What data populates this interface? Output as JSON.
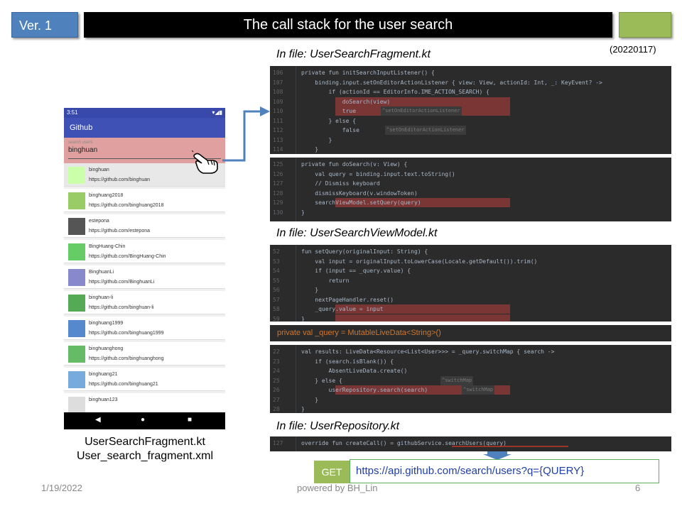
{
  "header": {
    "version": "Ver. 1",
    "title": "The call stack for the user search",
    "date_tag": "(20220117)"
  },
  "file_labels": {
    "fragment": "In file: UserSearchFragment.kt",
    "viewmodel": "In file: UserSearchViewModel.kt",
    "repository": "In file: UserRepository.kt"
  },
  "phone": {
    "status_time": "3:51",
    "app_title": "Github",
    "search_placeholder": "search users",
    "search_value": "binghuan",
    "users": [
      {
        "name": "binghuan",
        "url": "https://github.com/binghuan"
      },
      {
        "name": "binghuang2018",
        "url": "https://github.com/binghuang2018"
      },
      {
        "name": "estepona",
        "url": "https://github.com/estepona"
      },
      {
        "name": "BingHuang-Chin",
        "url": "https://github.com/BingHuang-Chin"
      },
      {
        "name": "BinghuanLi",
        "url": "https://github.com/BinghuanLi"
      },
      {
        "name": "binghuan-li",
        "url": "https://github.com/binghuan-li"
      },
      {
        "name": "binghuang1999",
        "url": "https://github.com/binghuang1999"
      },
      {
        "name": "binghuanghong",
        "url": "https://github.com/binghuanghong"
      },
      {
        "name": "binghuang21",
        "url": "https://github.com/binghuang21"
      },
      {
        "name": "binghuan123",
        "url": ""
      }
    ]
  },
  "caption": {
    "line1": "UserSearchFragment.kt",
    "line2": "User_search_fragment.xml"
  },
  "code": {
    "fragment_a": [
      {
        "ln": "106",
        "text": "private fun initSearchInputListener() {"
      },
      {
        "ln": "107",
        "text": "    binding.input.setOnEditorActionListener { view: View, actionId: Int, _: KeyEvent? ->"
      },
      {
        "ln": "108",
        "text": "        if (actionId == EditorInfo.IME_ACTION_SEARCH) {"
      },
      {
        "ln": "109",
        "text": "            doSearch(view)"
      },
      {
        "ln": "110",
        "text": "            true"
      },
      {
        "ln": "111",
        "text": "        } else {"
      },
      {
        "ln": "112",
        "text": "            false"
      },
      {
        "ln": "113",
        "text": "        }"
      },
      {
        "ln": "114",
        "text": "    }"
      }
    ],
    "fragment_a_hints": [
      "^setOnEditorActionListener",
      "^setOnEditorActionListener"
    ],
    "fragment_b": [
      {
        "ln": "125",
        "text": "private fun doSearch(v: View) {"
      },
      {
        "ln": "126",
        "text": "    val query = binding.input.text.toString()"
      },
      {
        "ln": "127",
        "text": "    // Dismiss keyboard"
      },
      {
        "ln": "128",
        "text": "    dismissKeyboard(v.windowToken)"
      },
      {
        "ln": "129",
        "text": "    searchViewModel.setQuery(query)"
      },
      {
        "ln": "130",
        "text": "}"
      }
    ],
    "viewmodel": [
      {
        "ln": "52",
        "text": "fun setQuery(originalInput: String) {"
      },
      {
        "ln": "53",
        "text": "    val input = originalInput.toLowerCase(Locale.getDefault()).trim()"
      },
      {
        "ln": "54",
        "text": "    if (input == _query.value) {"
      },
      {
        "ln": "55",
        "text": "        return"
      },
      {
        "ln": "56",
        "text": "    }"
      },
      {
        "ln": "57",
        "text": "    nextPageHandler.reset()"
      },
      {
        "ln": "58",
        "text": "    _query.value = input"
      },
      {
        "ln": "59",
        "text": "}"
      }
    ],
    "livedata_line": "private val _query = MutableLiveData<String>()",
    "results": [
      {
        "ln": "22",
        "text": "val results: LiveData<Resource<List<User>>> = _query.switchMap { search ->"
      },
      {
        "ln": "23",
        "text": "    if (search.isBlank()) {"
      },
      {
        "ln": "24",
        "text": "        AbsentLiveData.create()"
      },
      {
        "ln": "25",
        "text": "    } else {"
      },
      {
        "ln": "26",
        "text": "        userRepository.search(search)"
      },
      {
        "ln": "27",
        "text": "    }"
      },
      {
        "ln": "28",
        "text": "}"
      }
    ],
    "results_hints": [
      "^switchMap",
      "^switchMap"
    ],
    "repository": [
      {
        "ln": "127",
        "text": "override fun createCall() = githubService.searchUsers(query)"
      }
    ]
  },
  "request": {
    "method": "GET",
    "url": "https://api.github.com/search/users?q={QUERY}"
  },
  "footer": {
    "date": "1/19/2022",
    "powered": "powered by BH_Lin",
    "page": "6"
  },
  "colors": {
    "version_box": "#4f81bd",
    "title_bar": "#000000",
    "accent_green": "#9bbb59",
    "code_bg": "#2b2b2b",
    "highlight": "#7a3535",
    "app_bar": "#3f51b5",
    "search_bg": "#e1a0a0"
  }
}
